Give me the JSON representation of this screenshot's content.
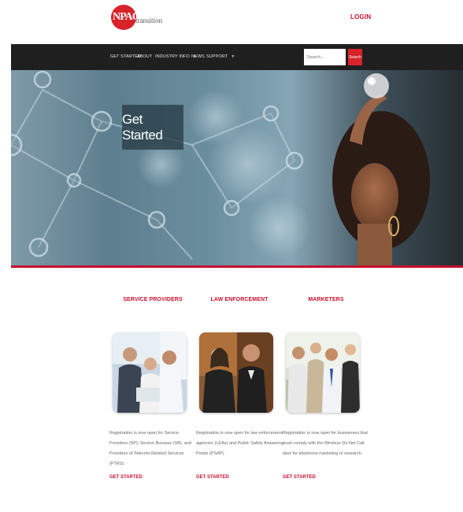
{
  "brand": {
    "logo_mark": "NPAC",
    "logo_word": "transition",
    "accent_color": "#c8102e"
  },
  "header": {
    "login_label": "LOGIN"
  },
  "nav": {
    "items": [
      {
        "label": "GET STARTED"
      },
      {
        "label": "ABOUT"
      },
      {
        "label": "INDUSTRY INFO",
        "dropdown": true
      },
      {
        "label": "NEWS"
      },
      {
        "label": "SUPPORT",
        "dropdown": true
      }
    ],
    "search_placeholder": "Search...",
    "search_button": "Search"
  },
  "hero": {
    "title": "Get Started"
  },
  "cards": [
    {
      "heading": "SERVICE PROVIDERS",
      "description": "Registration is now open for Service Providers (SP), Service Bureaus (SB), and Providers of Telecom-Related Services (PTRS).",
      "cta": "GET STARTED"
    },
    {
      "heading": "LAW ENFORCEMENT",
      "description": "Registration is now open for law enforcement agencies (LEAs) and Public Safety Answering Points (PSAP).",
      "cta": "GET STARTED"
    },
    {
      "heading": "MARKETERS",
      "description": "Registration is now open for businesses that must comply with the Wireless Do Not Call laws for telephone marketing or research.",
      "cta": "GET STARTED"
    }
  ]
}
